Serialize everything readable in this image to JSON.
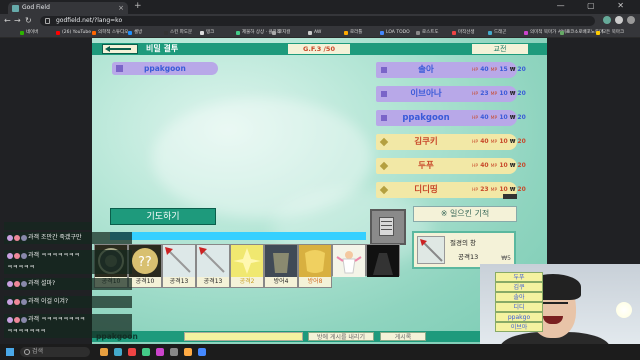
{
  "browser": {
    "tab_title": "God Field",
    "url": "godfield.net/?lang=ko",
    "bookmarks": [
      "네이버",
      "(26) YouTube",
      "의학적 스튜디오",
      "셀방",
      "스킨 파도문",
      "탱크",
      "제물하 상상 · 클로라",
      "로지컬",
      "AW",
      "로라틀",
      "LOA TODO",
      "로스트도",
      "마작선생",
      "드래곤",
      "의미적 북마가 서비스",
      "로코소로배포노트마",
      "모든 북마크"
    ]
  },
  "game": {
    "back_label": "",
    "title": "비밀 결투",
    "counter": "G.F.3 /50",
    "trade_label": "교전",
    "my_name": "ppakgoon",
    "players": [
      {
        "name": "솔아",
        "hp": "40",
        "mp": "15",
        "w": "20",
        "color": "purple"
      },
      {
        "name": "이브아나",
        "hp": "23",
        "mp": "10",
        "w": "20",
        "color": "purple"
      },
      {
        "name": "ppakgoon",
        "hp": "40",
        "mp": "10",
        "w": "20",
        "color": "purple"
      },
      {
        "name": "김쿠키",
        "hp": "40",
        "mp": "10",
        "w": "20",
        "color": "yellow"
      },
      {
        "name": "두푸",
        "hp": "40",
        "mp": "10",
        "w": "20",
        "color": "yellow"
      },
      {
        "name": "디디띵",
        "hp": "23",
        "mp": "10",
        "w": "20",
        "color": "yellow"
      }
    ],
    "stat_labels": {
      "hp": "HP",
      "mp": "MP",
      "w": "₩"
    },
    "pray_label": "기도하기",
    "miracle_label": "※ 일으킨 기적",
    "items": [
      {
        "label": "공격10",
        "icon": "dark-orb-icon",
        "style": ""
      },
      {
        "label": "공격10",
        "icon": "question-orb-icon",
        "style": ""
      },
      {
        "label": "공격13",
        "icon": "sword-icon",
        "style": ""
      },
      {
        "label": "공격13",
        "icon": "sword-icon",
        "style": ""
      },
      {
        "label": "공격2",
        "icon": "spark-icon",
        "style": "gold"
      },
      {
        "label": "방어4",
        "icon": "armor-icon",
        "style": ""
      },
      {
        "label": "방어8",
        "icon": "gold-armor-icon",
        "style": "orange"
      },
      {
        "label": "",
        "icon": "angel-icon",
        "style": ""
      },
      {
        "label": "",
        "icon": "dark-slab-icon",
        "style": ""
      }
    ],
    "card": {
      "name": "절경의 창",
      "stat": "공격13",
      "price": "₩5"
    },
    "bottom_name": "ppakgoon",
    "notice_btn": "방에 게시를 내리기",
    "post_btn": "게시록"
  },
  "chat": [
    {
      "text": "과객 조만간 죽겠구만"
    },
    {
      "text": "과객 ㅋㅋㅋㅋㅋㅋㅋ\nㅋㅋㅋㅋㅋ"
    },
    {
      "text": "과객 설마?"
    },
    {
      "text": "과객 이걸 이겨?"
    },
    {
      "text": "과객 ㅋㅋㅋㅋㅋㅋㅋㅋ\nㅋㅋㅋㅋㅋㅋㅋ"
    }
  ],
  "side_list": [
    "두푸",
    "김쿠",
    "솔아",
    "디디",
    "ppakgo",
    "이브아"
  ],
  "taskbar": {
    "search_placeholder": "검색"
  }
}
